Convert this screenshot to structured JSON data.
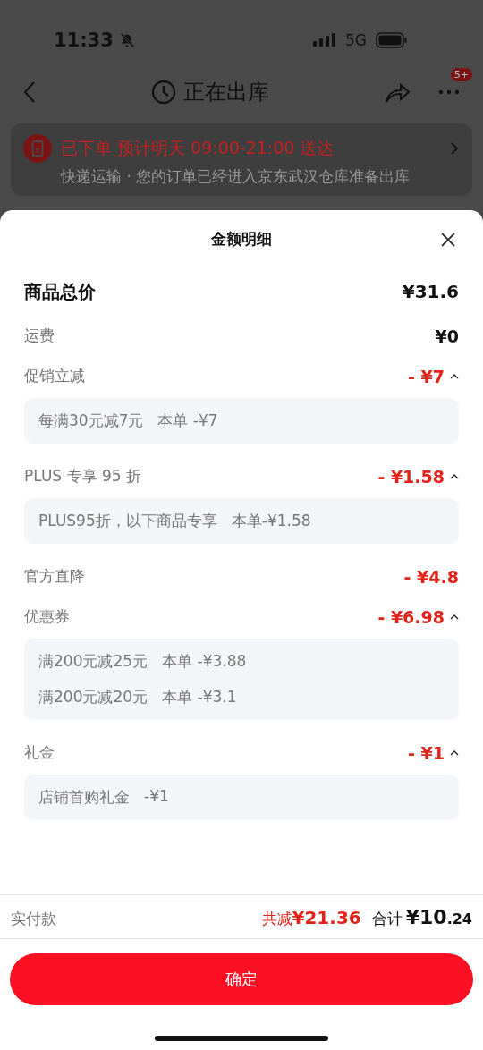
{
  "status_bar": {
    "time": "11:33",
    "network": "5G"
  },
  "nav": {
    "title": "正在出库",
    "badge": "5+"
  },
  "order_card": {
    "headline": "已下单 预计明天 09:00-21:00 送达",
    "detail": "快递运输 · 您的订单已经进入京东武汉仓库准备出库"
  },
  "sheet": {
    "title": "金额明细",
    "rows": [
      {
        "kind": "total",
        "label": "商品总价",
        "amount": "¥31.6"
      },
      {
        "kind": "plain",
        "label": "运费",
        "amount": "¥0"
      },
      {
        "kind": "discount",
        "label": "促销立减",
        "amount": "- ¥7",
        "expanded": true,
        "details": [
          {
            "condition": "每满30元减7元",
            "amount": "本单 -¥7"
          }
        ]
      },
      {
        "kind": "discount",
        "label": "PLUS 专享 95 折",
        "amount": "- ¥1.58",
        "expanded": true,
        "details": [
          {
            "condition": "PLUS95折，以下商品专享",
            "amount": "本单-¥1.58"
          }
        ]
      },
      {
        "kind": "reduction",
        "label": "官方直降",
        "amount": "- ¥4.8"
      },
      {
        "kind": "discount",
        "label": "优惠券",
        "amount": "- ¥6.98",
        "expanded": true,
        "details": [
          {
            "condition": "满200元减25元",
            "amount": "本单 -¥3.88"
          },
          {
            "condition": "满200元减20元",
            "amount": "本单 -¥3.1"
          }
        ]
      },
      {
        "kind": "discount",
        "label": "礼金",
        "amount": "- ¥1",
        "expanded": true,
        "details": [
          {
            "condition": "店铺首购礼金",
            "amount": "-¥1"
          }
        ]
      }
    ]
  },
  "footer": {
    "label": "实付款",
    "saved_label": "共减",
    "saved_amount": "¥21.36",
    "total_label": "合计",
    "total_integer": "¥10",
    "total_fraction": ".24"
  },
  "confirm_button": "确定"
}
